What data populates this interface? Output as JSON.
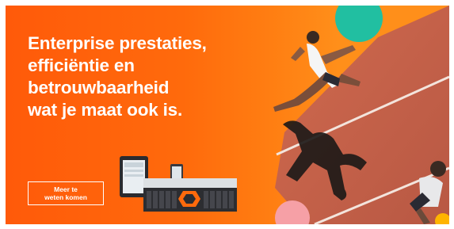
{
  "ad": {
    "headline_lines": [
      "Enterprise prestaties,",
      "efficiëntie en",
      "betrouwbaarheid",
      "wat je maat ook is."
    ],
    "cta_lines": [
      "Meer te",
      "weten komen"
    ]
  },
  "colors": {
    "brand_orange": "#ff6a0c",
    "track": "#c8664e",
    "teal_circle": "#21bfa1",
    "pink_circle": "#f6a0a6",
    "yellow_circle": "#ffb400"
  },
  "icons": {
    "product": "storage-array-with-tablet-icon",
    "runner": "runner-photo",
    "logo": "pure-logo-icon"
  }
}
